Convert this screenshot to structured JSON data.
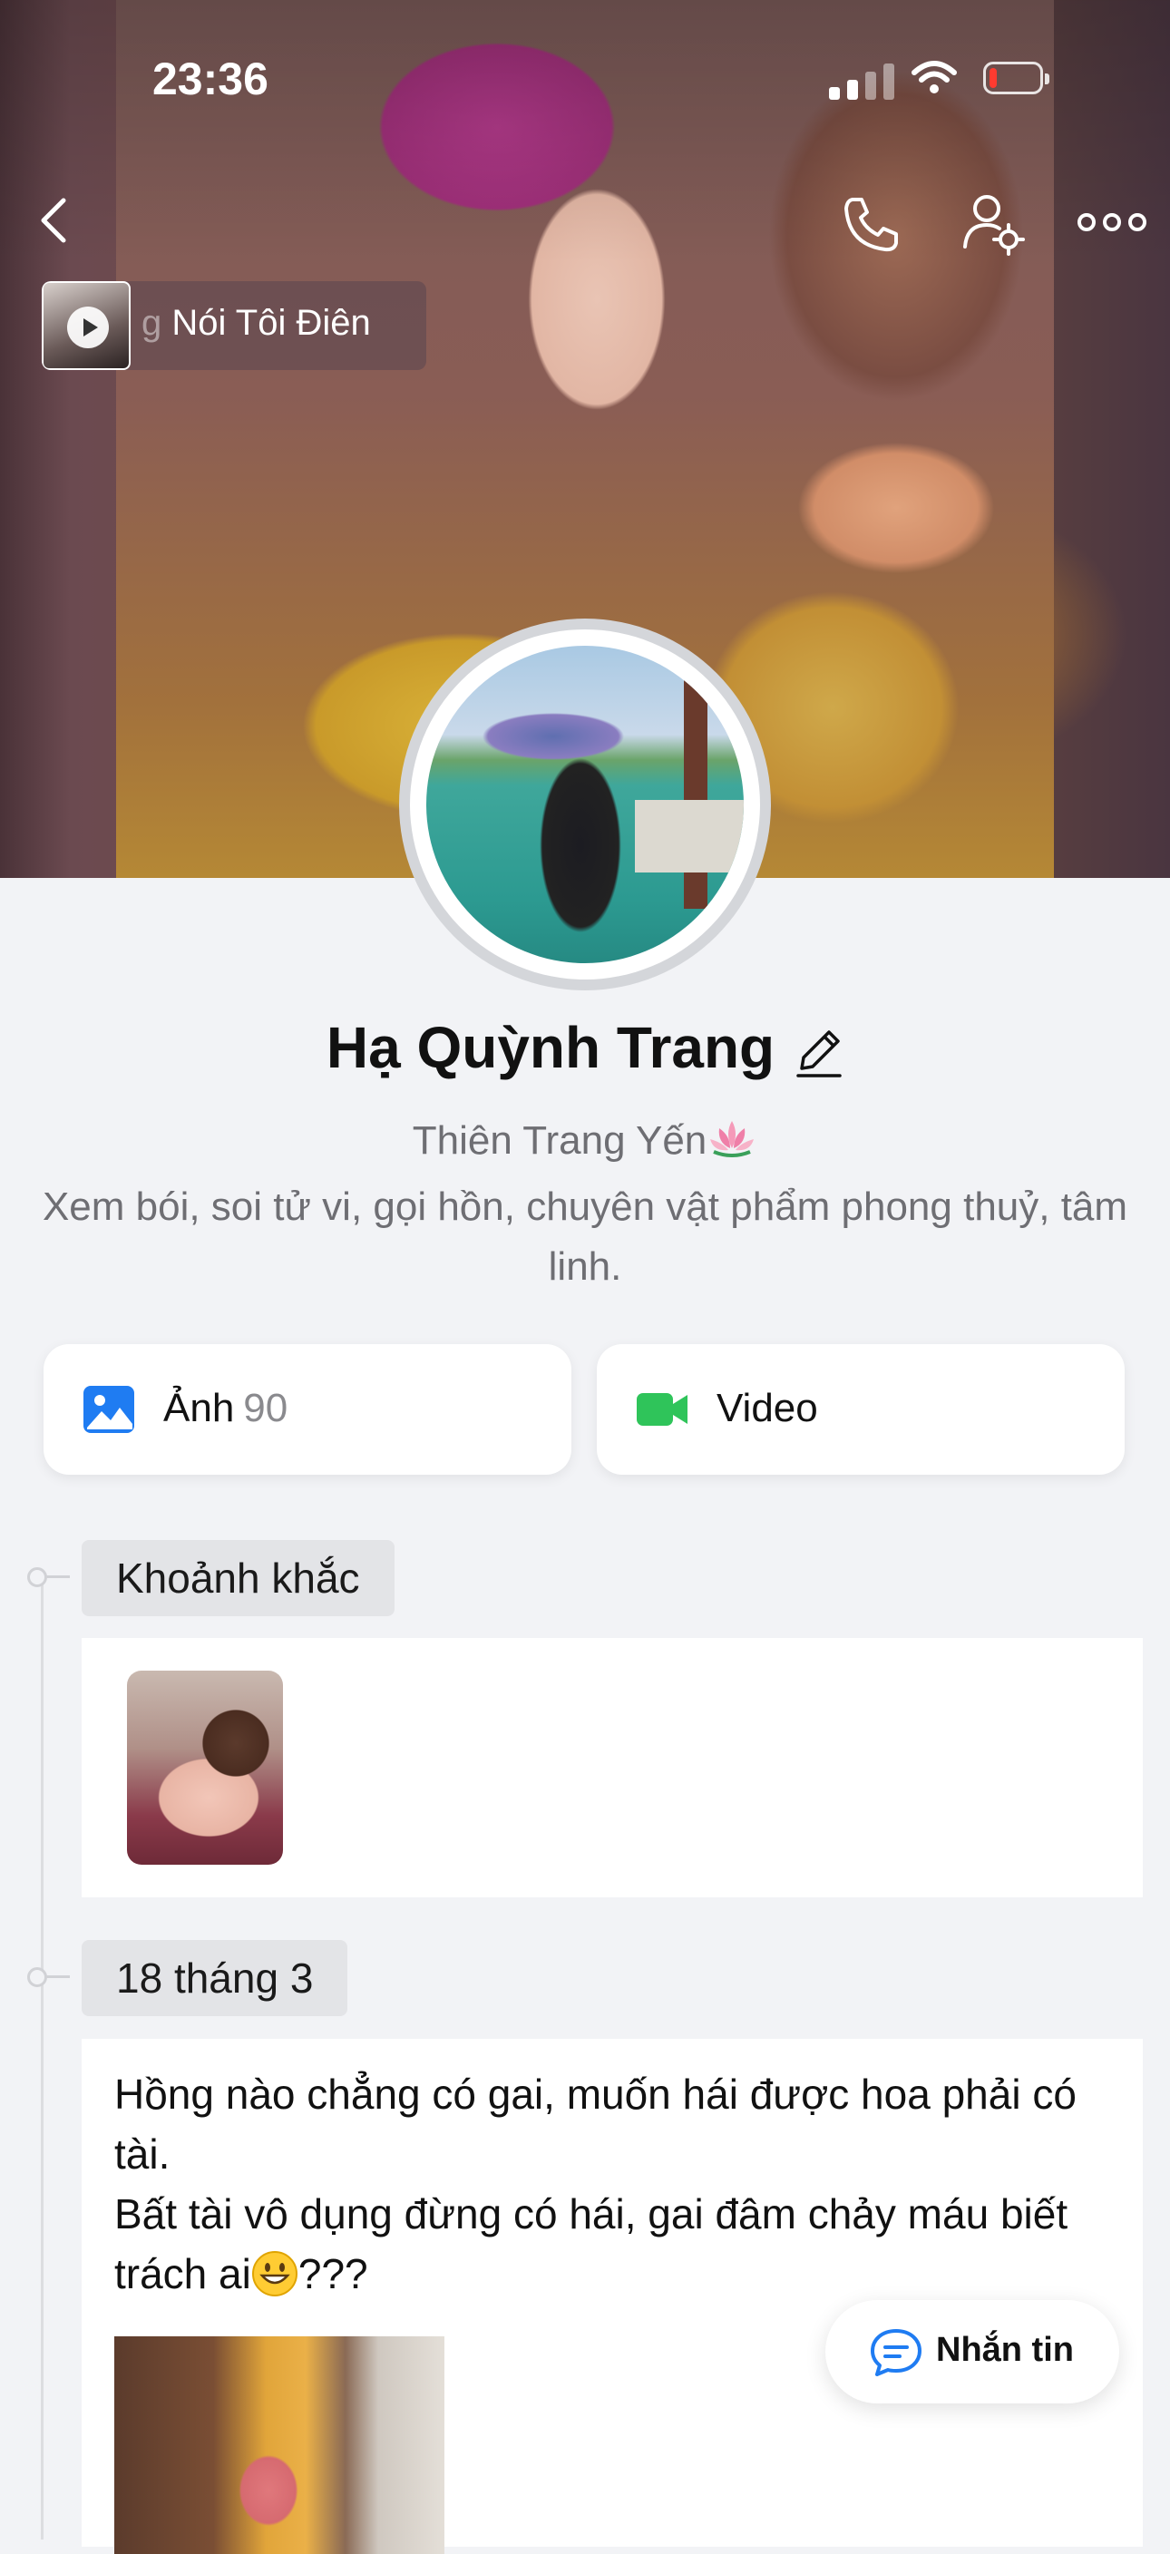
{
  "status_bar": {
    "time": "23:36"
  },
  "music": {
    "title_fade": "g ",
    "title": "Nói Tôi Điên"
  },
  "profile": {
    "name": "Hạ Quỳnh Trang",
    "bio_line1": "Thiên Trang Yến",
    "bio_line2": "Xem bói, soi tử vi, gọi hồn, chuyên vật phẩm phong thuỷ, tâm linh."
  },
  "media_buttons": {
    "photo_label": "Ảnh",
    "photo_count": "90",
    "video_label": "Video"
  },
  "timeline": {
    "moments_label": "Khoảnh khắc",
    "post_date": "18 tháng 3",
    "post_text_line1": "Hồng nào chẳng có gai, muốn hái được hoa phải có tài.",
    "post_text_line2a": "Bất tài vô dụng đừng có hái, gai đâm chảy máu biết trách ai",
    "post_text_line2b": "???"
  },
  "fab": {
    "message_label": "Nhắn tin"
  },
  "colors": {
    "photo_icon": "#1f7cf2",
    "video_icon": "#2fc45a",
    "message_icon": "#1f7cf2",
    "battery_low": "#ff3b30"
  },
  "icons": [
    "back-icon",
    "phone-icon",
    "user-gear-icon",
    "more-icon",
    "play-icon",
    "edit-icon",
    "lotus-icon",
    "photo-icon",
    "video-icon",
    "grinning-face-icon",
    "chat-bubble-icon"
  ]
}
